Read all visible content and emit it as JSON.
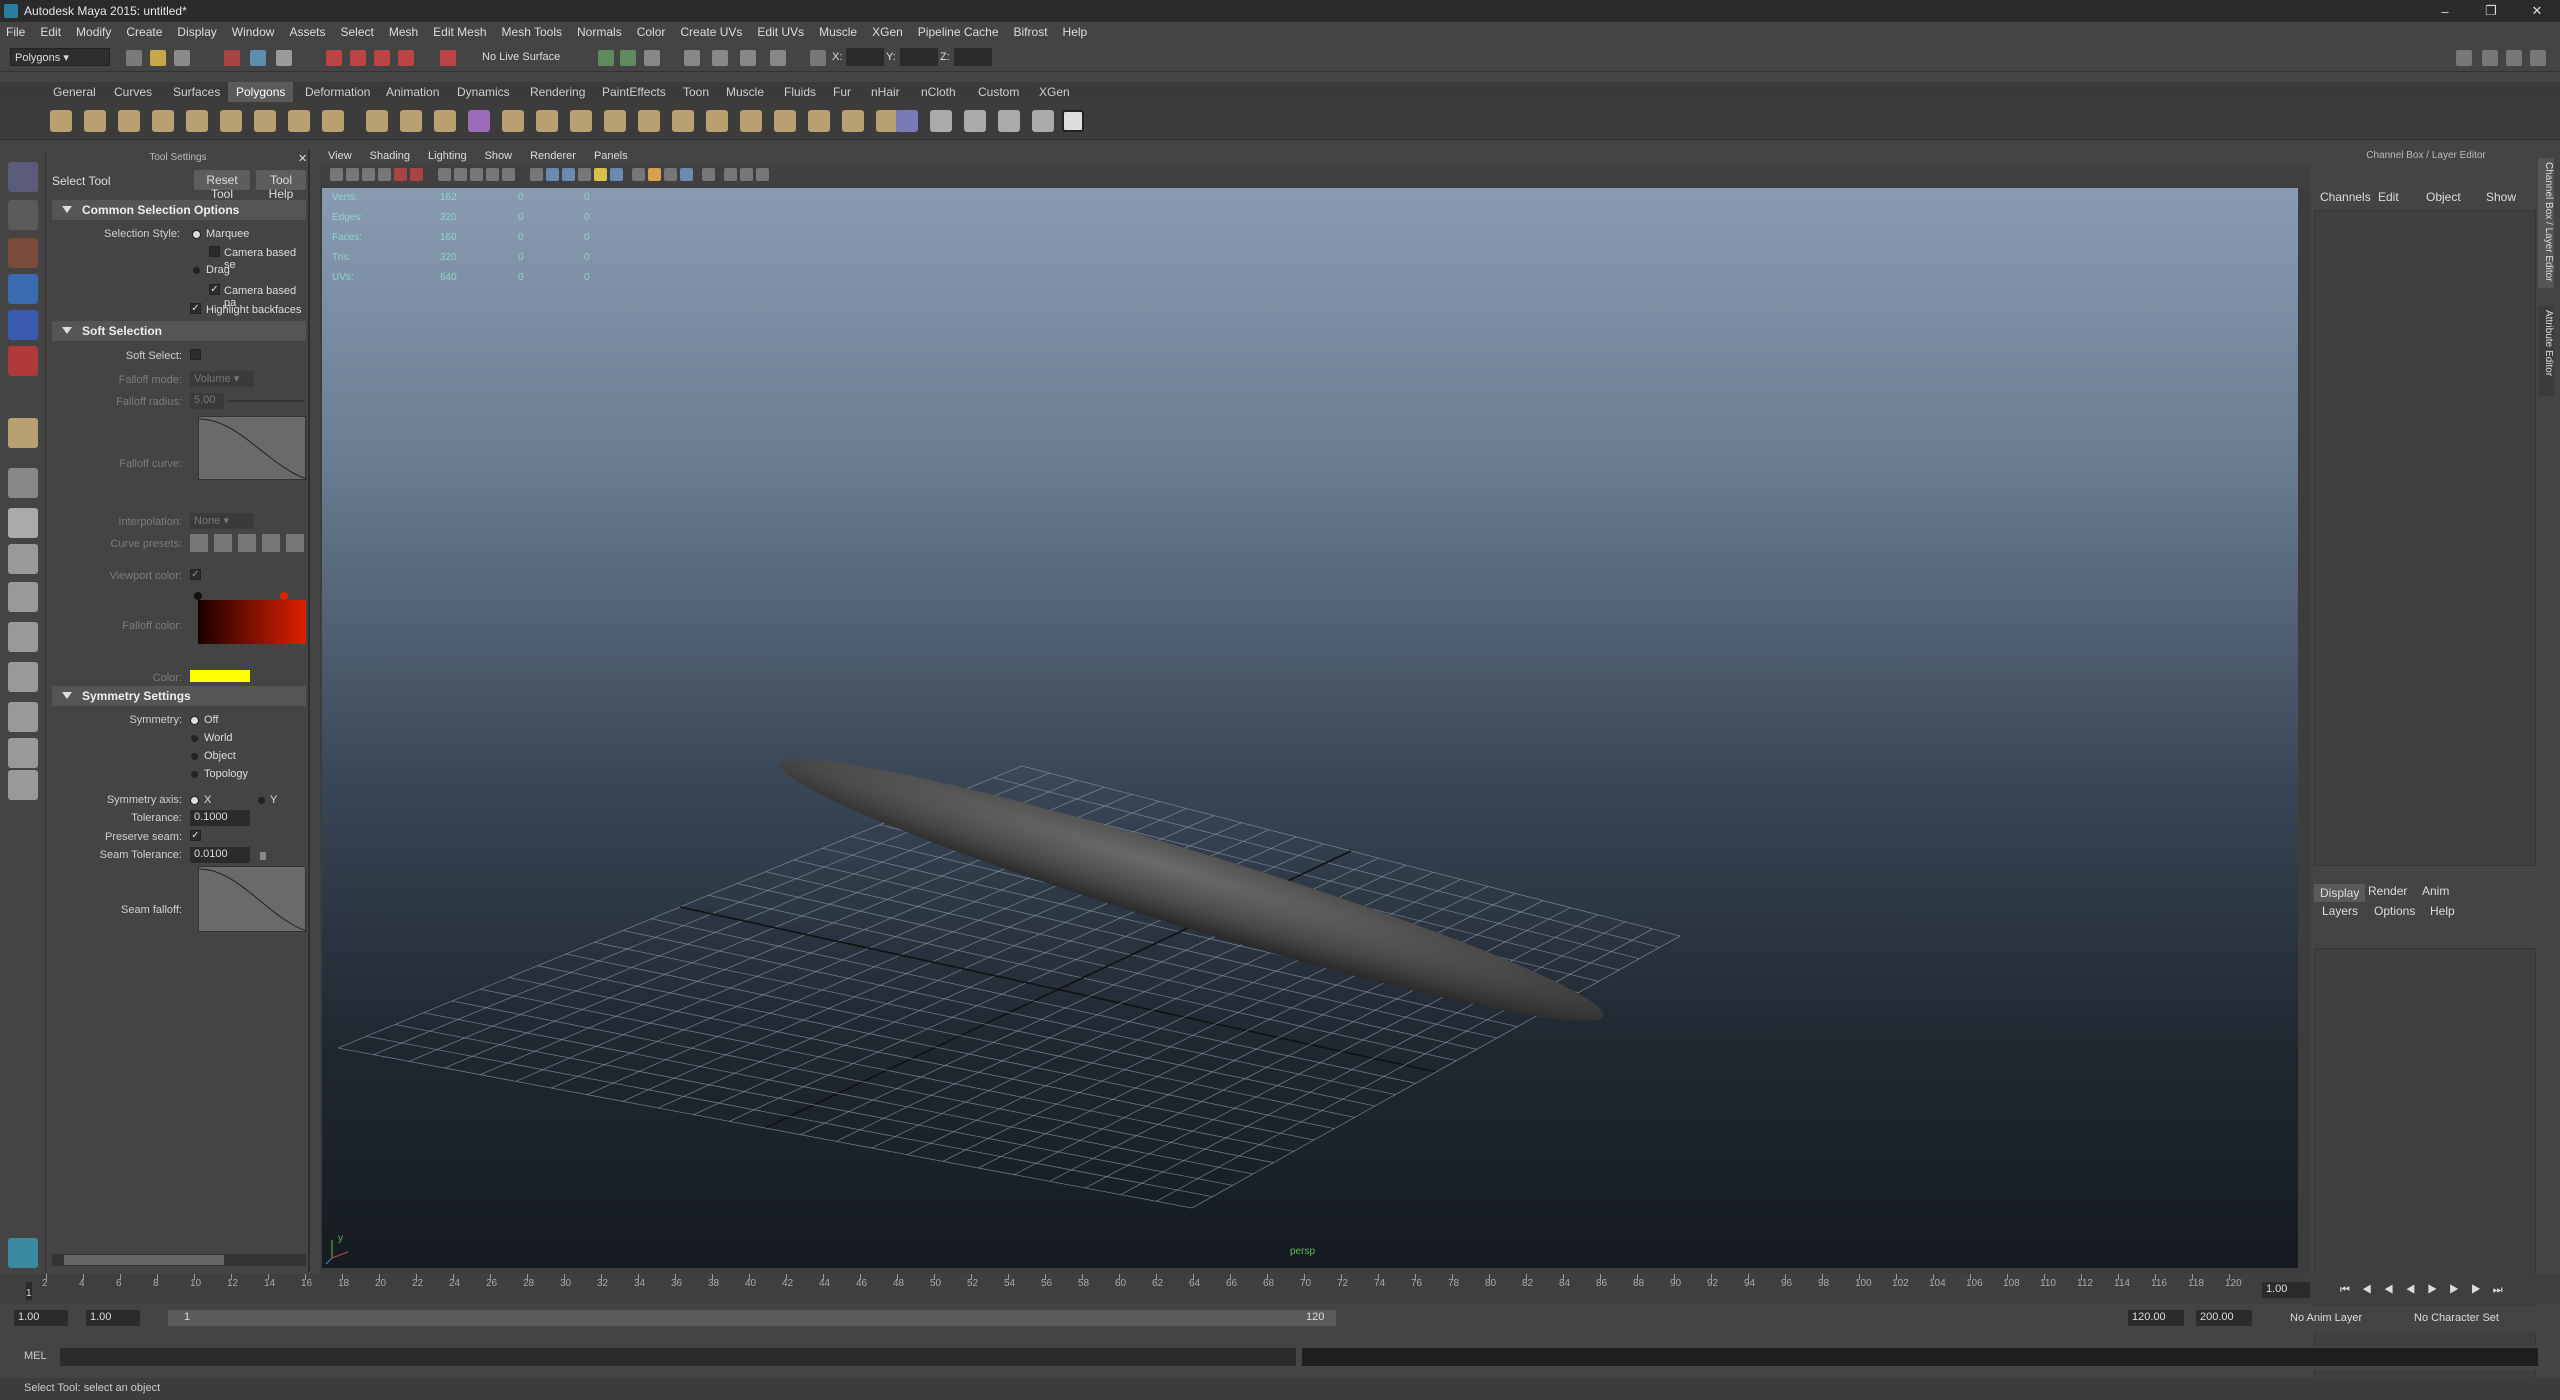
{
  "window": {
    "title": "Autodesk Maya 2015: untitled*",
    "minimize": "–",
    "restore": "❐",
    "close": "✕"
  },
  "menu": [
    "File",
    "Edit",
    "Modify",
    "Create",
    "Display",
    "Window",
    "Assets",
    "Select",
    "Mesh",
    "Edit Mesh",
    "Mesh Tools",
    "Normals",
    "Color",
    "Create UVs",
    "Edit UVs",
    "Muscle",
    "XGen",
    "Pipeline Cache",
    "Bifrost",
    "Help"
  ],
  "status": {
    "menuset": "Polygons",
    "live_surface": "No Live Surface",
    "x_label": "X:",
    "y_label": "Y:",
    "z_label": "Z:"
  },
  "shelf_tabs": [
    "General",
    "Curves",
    "Surfaces",
    "Polygons",
    "Deformation",
    "Animation",
    "Dynamics",
    "Rendering",
    "PaintEffects",
    "Toon",
    "Muscle",
    "Fluids",
    "Fur",
    "nHair",
    "nCloth",
    "Custom",
    "XGen"
  ],
  "shelf_active": "Polygons",
  "tool_settings": {
    "header": "Tool Settings",
    "tool_name": "Select Tool",
    "reset": "Reset Tool",
    "help": "Tool Help",
    "common": {
      "title": "Common Selection Options",
      "style_label": "Selection Style:",
      "marquee": "Marquee",
      "camera_based_sel": "Camera based se",
      "drag": "Drag",
      "camera_based_pa": "Camera based pa",
      "highlight_backfaces": "Highlight backfaces"
    },
    "soft": {
      "title": "Soft Selection",
      "soft_select": "Soft Select:",
      "falloff_mode": "Falloff mode:",
      "falloff_mode_value": "Volume",
      "falloff_radius": "Falloff radius:",
      "falloff_radius_value": "5.00",
      "falloff_curve": "Falloff curve:",
      "interpolation": "Interpolation:",
      "interpolation_value": "None",
      "curve_presets": "Curve presets:",
      "viewport_color": "Viewport color:",
      "falloff_color": "Falloff color:",
      "color": "Color:",
      "color_value": "#ffff00"
    },
    "symmetry": {
      "title": "Symmetry Settings",
      "symmetry": "Symmetry:",
      "options": [
        "Off",
        "World",
        "Object",
        "Topology"
      ],
      "axis": "Symmetry axis:",
      "axis_x": "X",
      "axis_y": "Y",
      "tolerance": "Tolerance:",
      "tolerance_value": "0.1000",
      "preserve_seam": "Preserve seam:",
      "seam_tolerance": "Seam Tolerance:",
      "seam_tolerance_value": "0.0100",
      "seam_falloff": "Seam falloff:"
    }
  },
  "viewport": {
    "menu": [
      "View",
      "Shading",
      "Lighting",
      "Show",
      "Renderer",
      "Panels"
    ],
    "hud": [
      {
        "label": "Verts:",
        "v1": "162",
        "v2": "0",
        "v3": "0"
      },
      {
        "label": "Edges:",
        "v1": "320",
        "v2": "0",
        "v3": "0"
      },
      {
        "label": "Faces:",
        "v1": "160",
        "v2": "0",
        "v3": "0"
      },
      {
        "label": "Tris:",
        "v1": "320",
        "v2": "0",
        "v3": "0"
      },
      {
        "label": "UVs:",
        "v1": "640",
        "v2": "0",
        "v3": "0"
      }
    ],
    "camera": "persp",
    "axis_y": "y"
  },
  "channel_box": {
    "header": "Channel Box / Layer Editor",
    "tabs": [
      "Channels",
      "Edit",
      "Object",
      "Show"
    ],
    "layer_tabs": [
      "Display",
      "Render",
      "Anim"
    ],
    "layer_menu": [
      "Layers",
      "Options",
      "Help"
    ],
    "side_tab1": "Channel Box / Layer Editor",
    "side_tab2": "Attribute Editor"
  },
  "timeline": {
    "ticks": [
      "2",
      "4",
      "6",
      "8",
      "10",
      "12",
      "14",
      "16",
      "18",
      "20",
      "22",
      "24",
      "26",
      "28",
      "30",
      "32",
      "34",
      "36",
      "38",
      "40",
      "42",
      "44",
      "46",
      "48",
      "50",
      "52",
      "54",
      "56",
      "58",
      "60",
      "62",
      "64",
      "66",
      "68",
      "70",
      "72",
      "74",
      "76",
      "78",
      "80",
      "82",
      "84",
      "86",
      "88",
      "90",
      "92",
      "94",
      "96",
      "98",
      "100",
      "102",
      "104",
      "106",
      "108",
      "110",
      "112",
      "114",
      "116",
      "118",
      "120"
    ],
    "current_frame": "1",
    "current_field": "1.00"
  },
  "range": {
    "start": "1.00",
    "start2": "1.00",
    "slider_start": "1",
    "slider_end": "120",
    "end": "120.00",
    "end2": "200.00",
    "anim_layer": "No Anim Layer",
    "char_set": "No Character Set"
  },
  "cmdline": {
    "label": "MEL"
  },
  "helpline": "Select Tool: select an object"
}
